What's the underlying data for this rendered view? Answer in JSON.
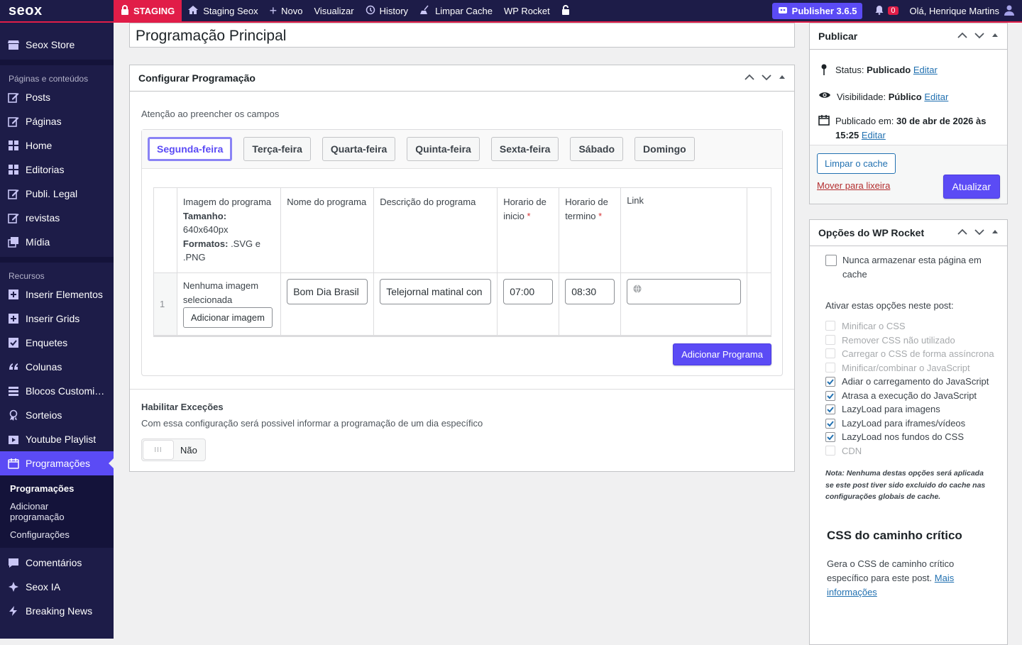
{
  "adminbar": {
    "logo": "seox",
    "staging": "STAGING",
    "site_name": "Staging Seox",
    "new": "Novo",
    "view": "Visualizar",
    "history": "History",
    "clear_cache": "Limpar Cache",
    "wp_rocket": "WP Rocket",
    "publisher": "Publisher 3.6.5",
    "notifications": "0",
    "greeting": "Olá, Henrique Martins"
  },
  "sidebar": {
    "store": "Seox Store",
    "section_pages": "Páginas e conteúdos",
    "pages_items": [
      "Posts",
      "Páginas",
      "Home",
      "Editorias",
      "Publi. Legal",
      "revistas",
      "Mídia"
    ],
    "section_resources": "Recursos",
    "resource_items": [
      "Inserir Elementos",
      "Inserir Grids",
      "Enquetes",
      "Colunas",
      "Blocos Customi…",
      "Sorteios",
      "Youtube Playlist"
    ],
    "active": "Programações",
    "submenu": [
      "Programações",
      "Adicionar programação",
      "Configurações"
    ],
    "bottom_items": [
      "Comentários",
      "Seox IA",
      "Breaking News"
    ]
  },
  "title": "Programação Principal",
  "config": {
    "heading": "Configurar Programação",
    "notice": "Atenção ao preencher os campos",
    "tabs": [
      "Segunda-feira",
      "Terça-feira",
      "Quarta-feira",
      "Quinta-feira",
      "Sexta-feira",
      "Sábado",
      "Domingo"
    ],
    "columns": {
      "image": "Imagem do programa",
      "size_label": "Tamanho:",
      "size_value": "640x640px",
      "formats_label": "Formatos:",
      "formats_value": ".SVG e .PNG",
      "name": "Nome do programa",
      "description": "Descrição do programa",
      "start": "Horario de inicio",
      "end": "Horario de termino",
      "link": "Link"
    },
    "row": {
      "index": "1",
      "no_image": "Nenhuma imagem selecionada",
      "add_image": "Adicionar imagem",
      "name": "Bom Dia Brasil",
      "description": "Telejornal matinal con",
      "start": "07:00",
      "end": "08:30",
      "link": ""
    },
    "add_program": "Adicionar Programa",
    "exceptions_title": "Habilitar Exceções",
    "exceptions_desc": "Com essa configuração será possivel informar a programação de um dia específico",
    "toggle_label": "Não"
  },
  "publish": {
    "heading": "Publicar",
    "status_label": "Status:",
    "status_value": "Publicado",
    "visibility_label": "Visibilidade:",
    "visibility_value": "Público",
    "published_label": "Publicado em:",
    "published_value": "30 de abr de 2026 às 15:25",
    "edit": "Editar",
    "clear_cache": "Limpar o cache",
    "trash": "Mover para lixeira",
    "update": "Atualizar"
  },
  "rocket": {
    "heading": "Opções do WP Rocket",
    "never_cache": "Nunca armazenar esta página em cache",
    "enable_label": "Ativar estas opções neste post:",
    "options": [
      {
        "label": "Minificar o CSS",
        "checked": false,
        "disabled": true
      },
      {
        "label": "Remover CSS não utilizado",
        "checked": false,
        "disabled": true
      },
      {
        "label": "Carregar o CSS de forma assíncrona",
        "checked": false,
        "disabled": true
      },
      {
        "label": "Minificar/combinar o JavaScript",
        "checked": false,
        "disabled": true
      },
      {
        "label": "Adiar o carregamento do JavaScript",
        "checked": true,
        "disabled": false
      },
      {
        "label": "Atrasa a execução do JavaScript",
        "checked": true,
        "disabled": false
      },
      {
        "label": "LazyLoad para imagens",
        "checked": true,
        "disabled": false
      },
      {
        "label": "LazyLoad para iframes/vídeos",
        "checked": true,
        "disabled": false
      },
      {
        "label": "LazyLoad nos fundos do CSS",
        "checked": true,
        "disabled": false
      },
      {
        "label": "CDN",
        "checked": false,
        "disabled": true
      }
    ],
    "note": "Nota: Nenhuma destas opções será aplicada se este post tiver sido excluido do cache nas configurações globais de cache.",
    "critical_title": "CSS do caminho crítico",
    "critical_desc": "Gera o CSS de caminho crítico específico para este post.",
    "more_info": "Mais informações"
  }
}
